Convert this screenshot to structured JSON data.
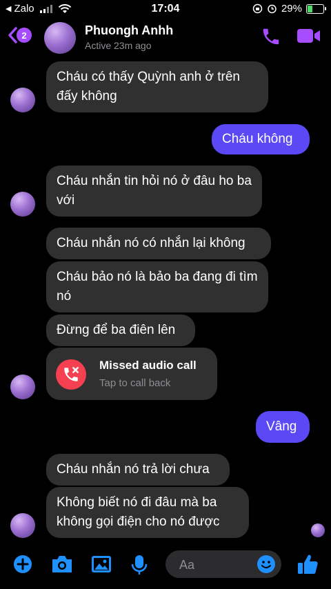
{
  "status_bar": {
    "back_app": "Zalo",
    "time": "17:04",
    "battery": "29%",
    "battery_level": 0.29
  },
  "header": {
    "contact_name": "Phuongh Anhh",
    "status": "Active 23m ago",
    "unread_count": "2"
  },
  "messages": [
    {
      "direction": "in",
      "text": "Cháu có thấy Quỳnh anh ở trên đấy không"
    },
    {
      "direction": "out",
      "text": "Cháu không"
    },
    {
      "direction": "in",
      "text": "Cháu nhắn tin hỏi nó ở đâu ho ba với"
    },
    {
      "direction": "in",
      "text": "Cháu nhắn nó có nhắn lại không"
    },
    {
      "direction": "in",
      "text": "Cháu bảo nó là  bảo ba đang đi tìm nó"
    },
    {
      "direction": "in",
      "text": "Đừng để ba điên lên"
    },
    {
      "direction": "out",
      "text": "Vâng"
    },
    {
      "direction": "in",
      "text": "Cháu nhắn nó trả lời chưa"
    },
    {
      "direction": "in",
      "text": "Không biết nó đi đâu mà ba không gọi điện cho nó được"
    }
  ],
  "missed_call": {
    "title": "Missed audio call",
    "subtitle": "Tap to call back"
  },
  "composer": {
    "placeholder": "Aa"
  },
  "icons": {
    "header": [
      "back-icon",
      "phone-icon",
      "video-camera-icon"
    ],
    "composer": [
      "plus-icon",
      "camera-icon",
      "image-icon",
      "microphone-icon",
      "emoji-icon",
      "thumbs-up-icon"
    ]
  },
  "colors": {
    "accent": "#a64dff",
    "outgoing_bubble": "#5b49f5",
    "incoming_bubble": "#303030",
    "missed_call": "#f44050",
    "composer_icon": "#1e90ff"
  }
}
